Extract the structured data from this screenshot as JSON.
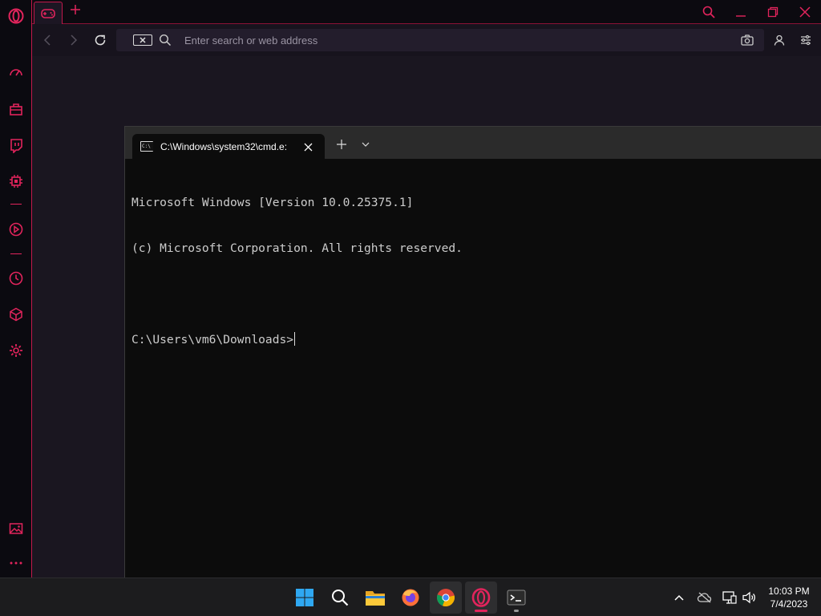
{
  "browser": {
    "address_placeholder": "Enter search or web address",
    "accent": "#e2245c"
  },
  "terminal": {
    "tab_title": "C:\\Windows\\system32\\cmd.e:",
    "lines": [
      "Microsoft Windows [Version 10.0.25375.1]",
      "(c) Microsoft Corporation. All rights reserved.",
      "",
      "C:\\Users\\vm6\\Downloads>"
    ]
  },
  "taskbar": {
    "time": "10:03 PM",
    "date": "7/4/2023"
  }
}
